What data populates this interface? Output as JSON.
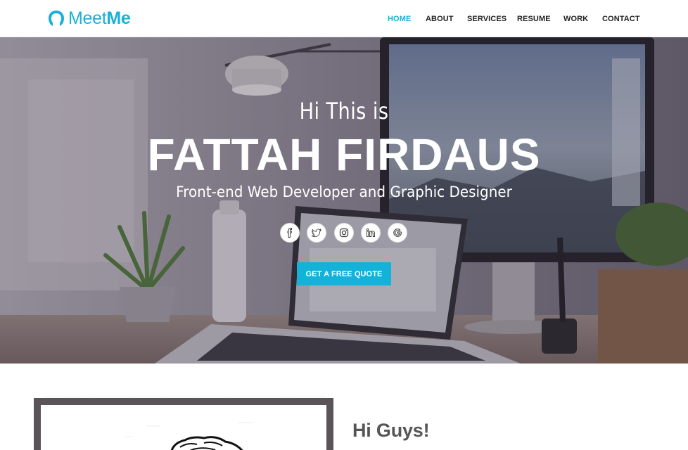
{
  "brand": {
    "name_part1": "Meet",
    "name_part2": "Me",
    "color": "#1ab0d8"
  },
  "nav": {
    "items": [
      {
        "label": "HOME",
        "active": true
      },
      {
        "label": "ABOUT",
        "active": false
      },
      {
        "label": "SERVICES",
        "active": false
      },
      {
        "label": "RESUME",
        "active": false
      },
      {
        "label": "WORK",
        "active": false
      },
      {
        "label": "CONTACT",
        "active": false
      }
    ]
  },
  "hero": {
    "greeting": "Hi This is",
    "name": "FATTAH FIRDAUS",
    "tagline": "Front-end Web Developer and Graphic Designer",
    "social": [
      {
        "icon": "facebook-icon"
      },
      {
        "icon": "twitter-icon"
      },
      {
        "icon": "instagram-icon"
      },
      {
        "icon": "linkedin-icon"
      },
      {
        "icon": "google-icon"
      }
    ],
    "cta_label": "GET A FREE QUOTE",
    "cta_color": "#14b2d9"
  },
  "about": {
    "heading": "Hi Guys!"
  }
}
